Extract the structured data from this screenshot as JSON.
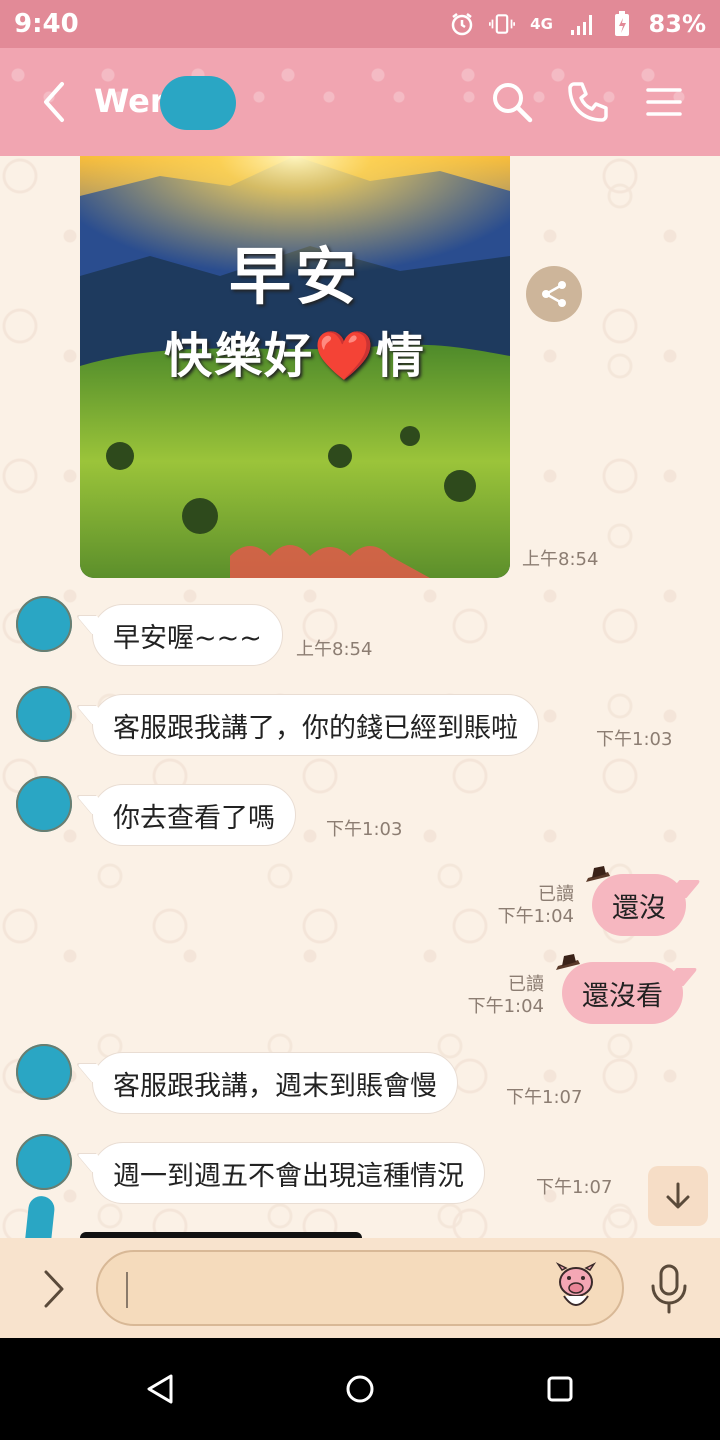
{
  "status_bar": {
    "time": "9:40",
    "network": "4G",
    "battery": "83%"
  },
  "header": {
    "contact_name": "Wen",
    "icons": [
      "back-icon",
      "search-icon",
      "phone-icon",
      "menu-icon"
    ]
  },
  "chat": {
    "image_message": {
      "caption_line1": "早安",
      "caption_line2": "快樂好❤️情",
      "time": "上午8:54"
    },
    "messages": [
      {
        "side": "in",
        "text": "早安喔~~~",
        "time": "上午8:54"
      },
      {
        "side": "in",
        "text": "客服跟我講了，你的錢已經到賬啦",
        "time": "下午1:03"
      },
      {
        "side": "in",
        "text": "你去查看了嗎",
        "time": "下午1:03"
      },
      {
        "side": "out",
        "text": "還沒",
        "read": "已讀",
        "time": "下午1:04"
      },
      {
        "side": "out",
        "text": "還沒看",
        "read": "已讀",
        "time": "下午1:04"
      },
      {
        "side": "in",
        "text": "客服跟我講，週末到賬會慢",
        "time": "下午1:07"
      },
      {
        "side": "in",
        "text": "週一到週五不會出現這種情況",
        "time": "下午1:07"
      }
    ]
  },
  "input_bar": {
    "placeholder": ""
  },
  "colors": {
    "header": "#f1a5b1",
    "status_bar": "#e28a97",
    "outgoing_bubble": "#f6b7c0",
    "incoming_bubble": "#ffffff",
    "input_bar": "#f8e3cd"
  }
}
